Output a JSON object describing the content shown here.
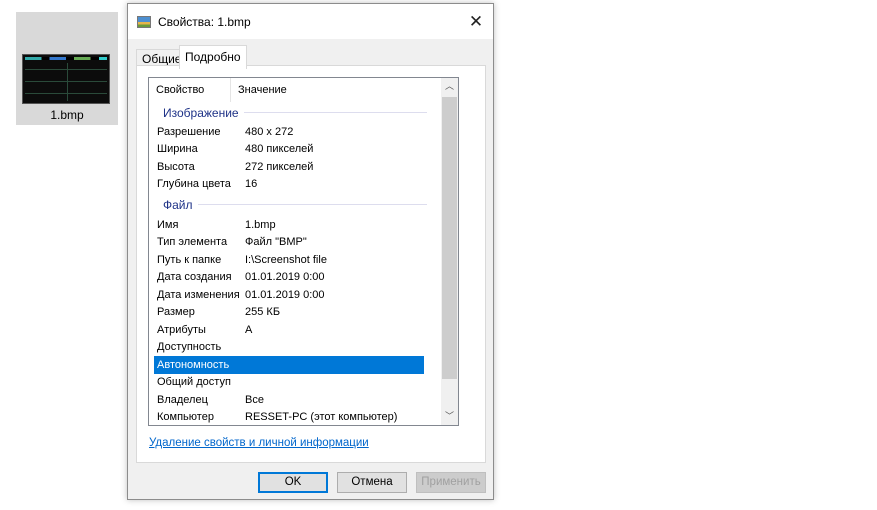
{
  "desktop": {
    "file_name": "1.bmp"
  },
  "dialog": {
    "title": "Свойства: 1.bmp",
    "tabs": [
      {
        "label": "Общие"
      },
      {
        "label": "Подробно"
      }
    ],
    "columns": {
      "property": "Свойство",
      "value": "Значение"
    },
    "groups": [
      {
        "label": "Изображение",
        "rows": [
          {
            "k": "Разрешение",
            "v": "480 x 272"
          },
          {
            "k": "Ширина",
            "v": "480 пикселей"
          },
          {
            "k": "Высота",
            "v": "272 пикселей"
          },
          {
            "k": "Глубина цвета",
            "v": "16"
          }
        ]
      },
      {
        "label": "Файл",
        "rows": [
          {
            "k": "Имя",
            "v": "1.bmp"
          },
          {
            "k": "Тип элемента",
            "v": "Файл \"BMP\""
          },
          {
            "k": "Путь к папке",
            "v": "I:\\Screenshot file"
          },
          {
            "k": "Дата создания",
            "v": "01.01.2019 0:00"
          },
          {
            "k": "Дата изменения",
            "v": "01.01.2019 0:00"
          },
          {
            "k": "Размер",
            "v": "255 КБ"
          },
          {
            "k": "Атрибуты",
            "v": "А"
          },
          {
            "k": "Доступность",
            "v": ""
          },
          {
            "k": "Автономность",
            "v": "",
            "selected": true
          },
          {
            "k": "Общий доступ",
            "v": ""
          },
          {
            "k": "Владелец",
            "v": "Все"
          },
          {
            "k": "Компьютер",
            "v": "RESSET-PC (этот компьютер)"
          }
        ]
      }
    ],
    "link": "Удаление свойств и личной информации",
    "buttons": {
      "ok": "OK",
      "cancel": "Отмена",
      "apply": "Применить"
    }
  }
}
